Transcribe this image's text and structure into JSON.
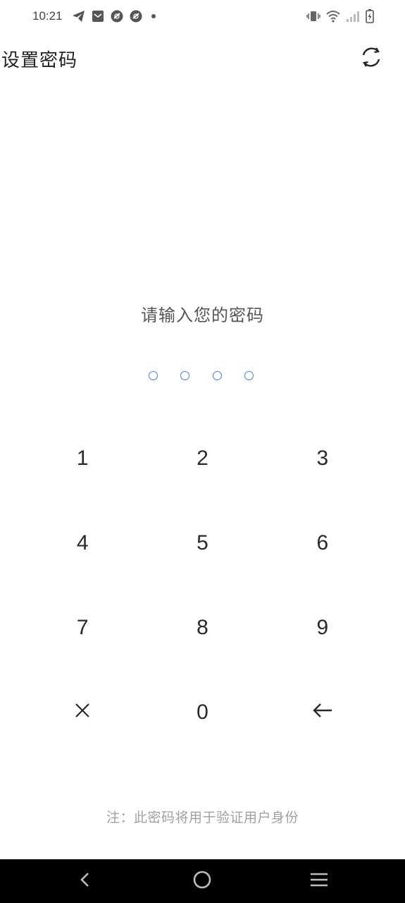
{
  "status_bar": {
    "time": "10:21",
    "left_icons": [
      "telegram-icon",
      "mail-icon",
      "app-badge-icon",
      "app-badge-icon",
      "more-dot-icon"
    ],
    "right_icons": [
      "vibrate-icon",
      "wifi-icon",
      "signal-icon",
      "battery-charging-icon"
    ]
  },
  "app_bar": {
    "title": "设置密码",
    "action_icon": "refresh-icon"
  },
  "prompt": "请输入您的密码",
  "pin": {
    "length": 4,
    "filled": 0,
    "dot_color": "#4a7bd0"
  },
  "keypad": {
    "keys": [
      "1",
      "2",
      "3",
      "4",
      "5",
      "6",
      "7",
      "8",
      "9",
      "×",
      "0",
      "←"
    ],
    "clear_icon": "close-icon",
    "backspace_icon": "arrow-left-icon"
  },
  "note": "注：此密码将用于验证用户身份",
  "nav_bar": {
    "buttons": [
      "back-icon",
      "home-icon",
      "recents-icon"
    ]
  }
}
